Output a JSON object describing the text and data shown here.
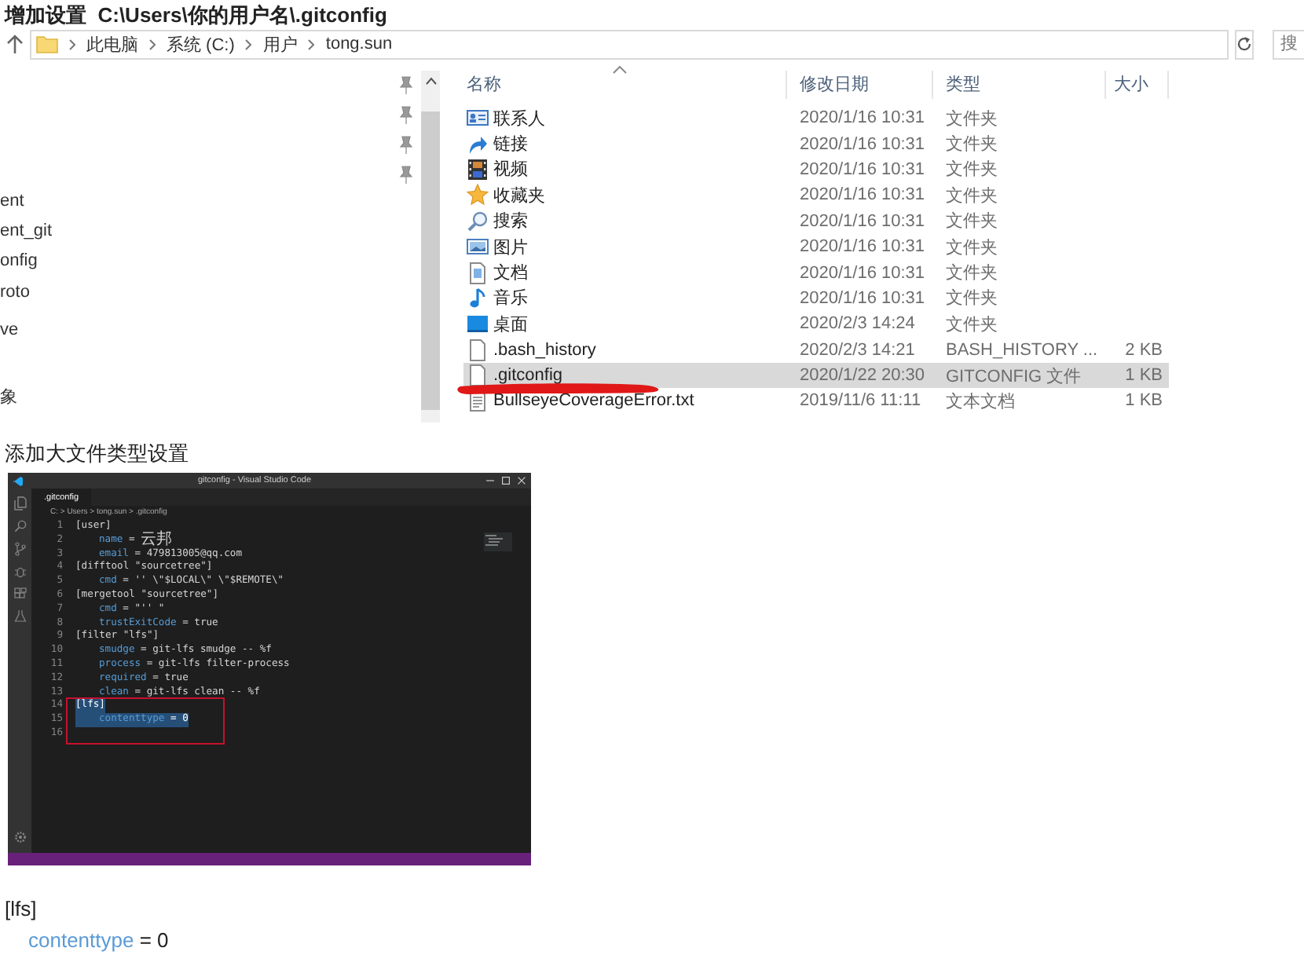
{
  "heading": "增加设置  C:\\Users\\你的用户名\\.gitconfig",
  "explorer": {
    "breadcrumb": [
      "此电脑",
      "系统 (C:)",
      "用户",
      "tong.sun"
    ],
    "search_placeholder": "搜",
    "nav_items": [
      "ent",
      "ent_git",
      "onfig",
      "roto",
      "ve",
      "象"
    ],
    "columns": [
      "名称",
      "修改日期",
      "类型",
      "大小"
    ],
    "rows": [
      {
        "kind": "contacts",
        "name": "联系人",
        "date": "2020/1/16 10:31",
        "type": "文件夹",
        "selected": false
      },
      {
        "kind": "link",
        "name": "链接",
        "date": "2020/1/16 10:31",
        "type": "文件夹",
        "selected": false
      },
      {
        "kind": "video",
        "name": "视频",
        "date": "2020/1/16 10:31",
        "type": "文件夹",
        "selected": false
      },
      {
        "kind": "favorites",
        "name": "收藏夹",
        "date": "2020/1/16 10:31",
        "type": "文件夹",
        "selected": false
      },
      {
        "kind": "search",
        "name": "搜索",
        "date": "2020/1/16 10:31",
        "type": "文件夹",
        "selected": false
      },
      {
        "kind": "pictures",
        "name": "图片",
        "date": "2020/1/16 10:31",
        "type": "文件夹",
        "selected": false
      },
      {
        "kind": "documents",
        "name": "文档",
        "date": "2020/1/16 10:31",
        "type": "文件夹",
        "selected": false
      },
      {
        "kind": "music",
        "name": "音乐",
        "date": "2020/1/16 10:31",
        "type": "文件夹",
        "selected": false
      },
      {
        "kind": "desktop",
        "name": "桌面",
        "date": "2020/2/3 14:24",
        "type": "文件夹",
        "selected": false
      },
      {
        "kind": "file",
        "name": ".bash_history",
        "date": "2020/2/3 14:21",
        "type": "BASH_HISTORY ...",
        "size": "2 KB",
        "selected": false
      },
      {
        "kind": "file",
        "name": ".gitconfig",
        "date": "2020/1/22 20:30",
        "type": "GITCONFIG 文件",
        "size": "1 KB",
        "selected": true
      },
      {
        "kind": "text",
        "name": "BullseyeCoverageError.txt",
        "date": "2019/11/6 11:11",
        "type": "文本文档",
        "size": "1 KB",
        "selected": false
      }
    ]
  },
  "subheading": "添加大文件类型设置",
  "editor": {
    "title": "gitconfig - Visual Studio Code",
    "tab": ".gitconfig",
    "breadcrumb": "C: > Users > tong.sun > .gitconfig",
    "lines": [
      {
        "number": "1",
        "section": "[user]",
        "selected": false
      },
      {
        "number": "2",
        "key": "name",
        "sign": "=",
        "value": "云邦",
        "selected": false
      },
      {
        "number": "3",
        "key": "email",
        "sign": "=",
        "value": "479813005@qq.com",
        "selected": false
      },
      {
        "number": "4",
        "section": "[difftool \"sourcetree\"]",
        "selected": false
      },
      {
        "number": "5",
        "key": "cmd",
        "sign": "=",
        "value": "'' \\\"$LOCAL\\\" \\\"$REMOTE\\\"",
        "selected": false
      },
      {
        "number": "6",
        "section": "[mergetool \"sourcetree\"]",
        "selected": false
      },
      {
        "number": "7",
        "key": "cmd",
        "sign": "=",
        "value": "\"'' \"",
        "selected": false
      },
      {
        "number": "8",
        "key": "trustExitCode",
        "sign": "=",
        "value": "true",
        "selected": false
      },
      {
        "number": "9",
        "section": "[filter \"lfs\"]",
        "selected": false
      },
      {
        "number": "10",
        "key": "smudge",
        "sign": "=",
        "value": "git-lfs smudge -- %f",
        "selected": false
      },
      {
        "number": "11",
        "key": "process",
        "sign": "=",
        "value": "git-lfs filter-process",
        "selected": false
      },
      {
        "number": "12",
        "key": "required",
        "sign": "=",
        "value": "true",
        "selected": false
      },
      {
        "number": "13",
        "key": "clean",
        "sign": "=",
        "value": "git-lfs clean -- %f",
        "selected": false
      },
      {
        "number": "14",
        "section": "[lfs]",
        "selected": true
      },
      {
        "number": "15",
        "key": "contenttype",
        "sign": "=",
        "value": "0",
        "selected": true
      },
      {
        "number": "16",
        "selected": false
      }
    ]
  },
  "snippet": {
    "section": "[lfs]",
    "key": "contenttype",
    "sign": "=",
    "value": "0"
  }
}
